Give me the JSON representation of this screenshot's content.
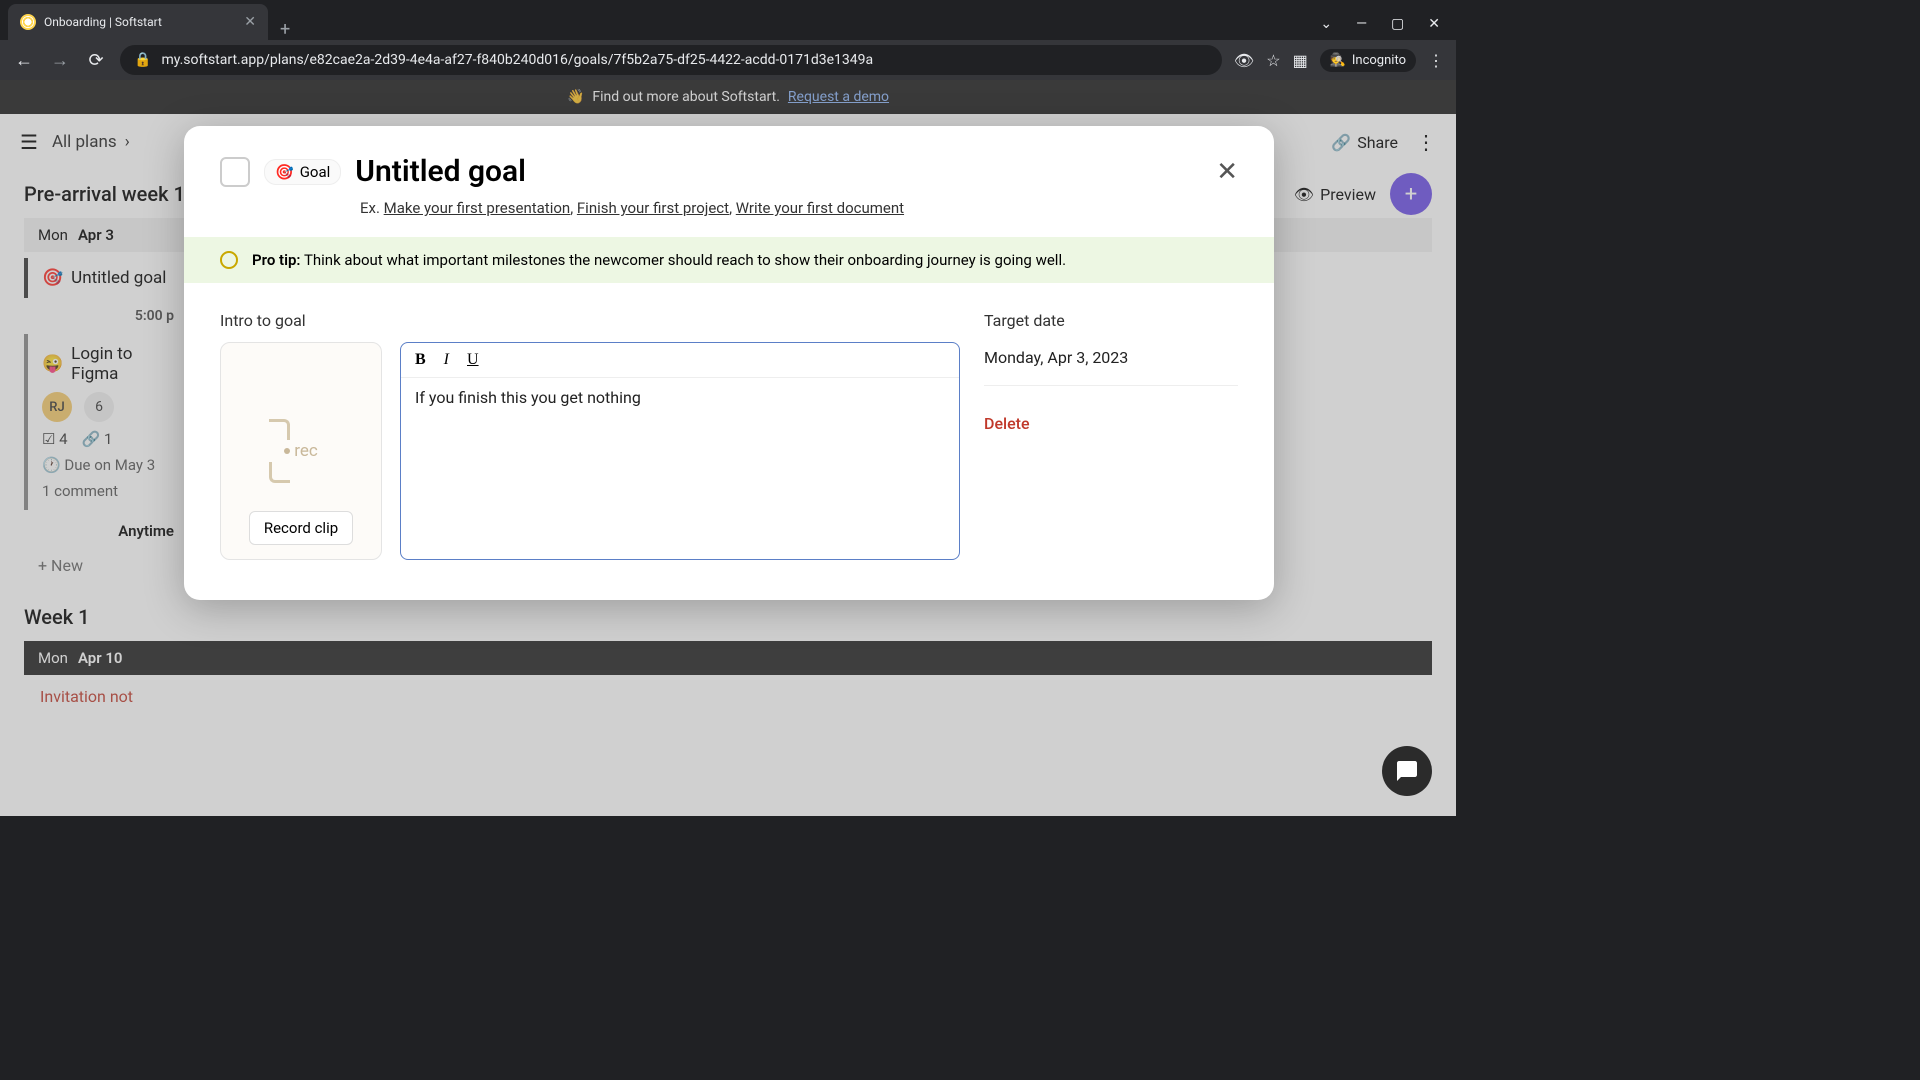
{
  "browser": {
    "tab_title": "Onboarding | Softstart",
    "url": "my.softstart.app/plans/e82cae2a-2d39-4e4a-af27-f840b240d016/goals/7f5b2a75-df25-4422-acdd-0171d3e1349a",
    "incognito": "Incognito"
  },
  "banner": {
    "emoji": "👋",
    "text": "Find out more about Softstart.",
    "link": "Request a demo"
  },
  "header": {
    "breadcrumb": "All plans",
    "share": "Share",
    "preview": "Preview"
  },
  "sections": {
    "prearrival": "Pre-arrival week 1",
    "week1": "Week 1"
  },
  "day1": {
    "dow": "Mon",
    "date": "Apr 3"
  },
  "day2": {
    "dow": "Mon",
    "date": "Apr 10"
  },
  "card1": {
    "title": "Untitled goal",
    "time": "5:00 p",
    "task": "Login to Figma",
    "avatar": "RJ",
    "count": "6",
    "checks": "4",
    "links": "1",
    "due": "Due on May 3",
    "comments": "1 comment",
    "anytime": "Anytime",
    "new": "New",
    "invitation": "Invitation not"
  },
  "modal": {
    "badge": "Goal",
    "title": "Untitled goal",
    "ex_label": "Ex.",
    "ex1": "Make your first presentation",
    "ex2": "Finish your first project",
    "ex3": "Write your first document",
    "protip_label": "Pro tip:",
    "protip_text": "Think about what important milestones the newcomer should reach to show their onboarding journey is going well.",
    "intro_label": "Intro to goal",
    "rec_text": "rec",
    "record_btn": "Record clip",
    "editor_text": "If you finish this you get nothing",
    "target_label": "Target date",
    "target_value": "Monday, Apr 3, 2023",
    "delete": "Delete"
  }
}
